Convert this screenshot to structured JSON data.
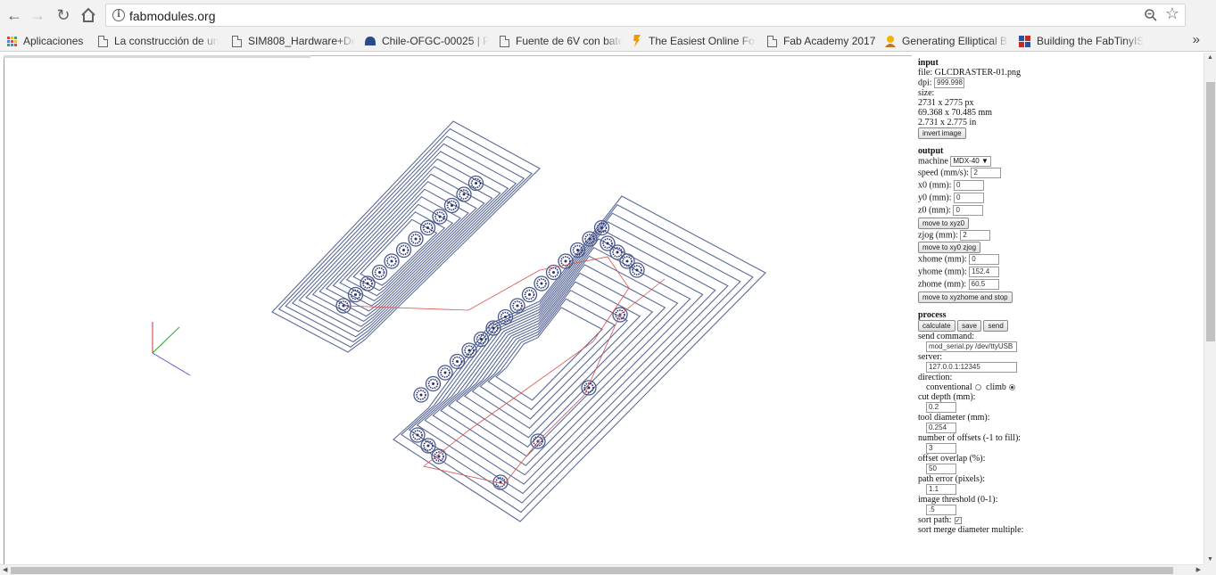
{
  "browser": {
    "url": "fabmodules.org",
    "bookmarks": [
      {
        "label": "Aplicaciones",
        "icon": "apps-grid-icon"
      },
      {
        "label": "La construcción de un",
        "icon": "page-icon"
      },
      {
        "label": "SIM808_Hardware+De",
        "icon": "page-icon"
      },
      {
        "label": "Chile-OFGC-00025 | P",
        "icon": "page-icon"
      },
      {
        "label": "Fuente de 6V con bate",
        "icon": "page-icon"
      },
      {
        "label": "The Easiest Online For",
        "icon": "bookmark-flag-icon"
      },
      {
        "label": "Fab Academy 2017",
        "icon": "page-icon"
      },
      {
        "label": "Generating Elliptical B",
        "icon": "avatar-icon"
      },
      {
        "label": "Building the FabTinyIS",
        "icon": "grid-icon"
      }
    ],
    "more_label": "»"
  },
  "panel": {
    "input": {
      "title": "input",
      "file_label": "file:",
      "file_name": "GLCDRASTER-01.png",
      "dpi_label": "dpi:",
      "dpi_value": "999.998",
      "size_label": "size:",
      "size_px": "2731 x 2775 px",
      "size_mm": "69.368 x 70.485 mm",
      "size_in": "2.731 x 2.775 in",
      "invert_button": "invert image"
    },
    "output": {
      "title": "output",
      "machine_label": "machine",
      "machine_value": "MDX-40 ▼",
      "speed_label": "speed (mm/s):",
      "speed_value": "2",
      "x0_label": "x0 (mm):",
      "x0_value": "0",
      "y0_label": "y0 (mm):",
      "y0_value": "0",
      "z0_label": "z0 (mm):",
      "z0_value": "0",
      "move_xyz0_button": "move to xyz0",
      "zjog_label": "zjog (mm):",
      "zjog_value": "2",
      "move_xy0_button": "move to xy0 zjog",
      "xhome_label": "xhome (mm):",
      "xhome_value": "0",
      "yhome_label": "yhome (mm):",
      "yhome_value": "152.4",
      "zhome_label": "zhome (mm):",
      "zhome_value": "60.5",
      "move_home_button": "move to xyzhome and stop"
    },
    "process": {
      "title": "process",
      "calculate_button": "calculate",
      "save_button": "save",
      "send_button": "send",
      "send_command_label": "send command:",
      "send_command_value": "mod_serial.py /dev/ttyUSB",
      "server_label": "server:",
      "server_value": "127.0.0.1:12345",
      "direction_label": "direction:",
      "conventional_label": "conventional",
      "climb_label": "climb",
      "cut_depth_label": "cut depth (mm):",
      "cut_depth_value": "0.2",
      "tool_diameter_label": "tool diameter (mm):",
      "tool_diameter_value": "0.254",
      "offsets_label": "number of offsets (-1 to fill):",
      "offsets_value": "3",
      "overlap_label": "offset overlap (%):",
      "overlap_value": "50",
      "path_error_label": "path error (pixels):",
      "path_error_value": "1.1",
      "threshold_label": "image threshold (0-1):",
      "threshold_value": ".5",
      "sort_path_label": "sort path:",
      "sort_merge_label": "sort merge diameter multiple:"
    }
  },
  "colors": {
    "toolpath": "#4a5a8c",
    "rapid": "#d9534f",
    "pad": "#2a2f6e",
    "axis_x": "#5555cc",
    "axis_y": "#22aa22",
    "axis_z": "#cc3333"
  }
}
